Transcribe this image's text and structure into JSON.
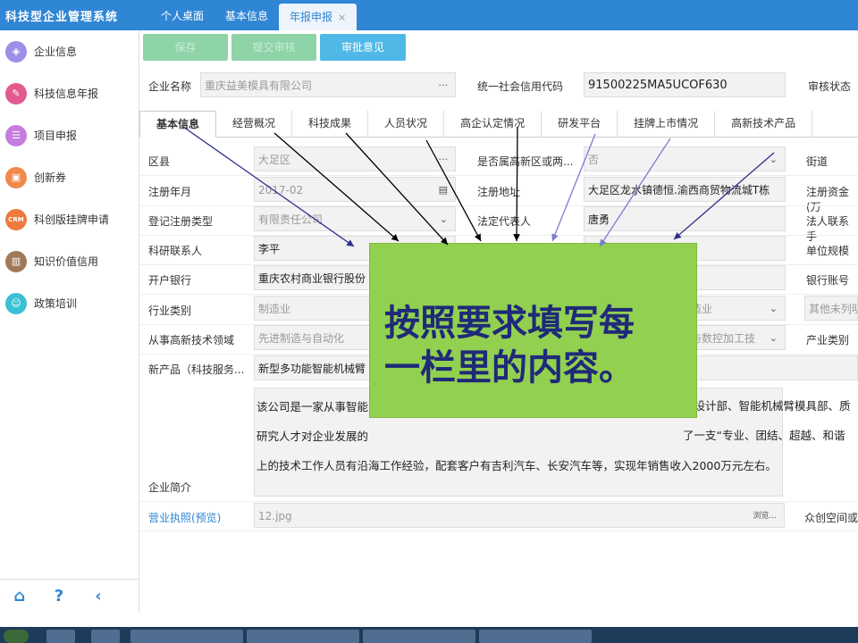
{
  "app": {
    "title": "科技型企业管理系统"
  },
  "tabs": [
    {
      "label": "个人桌面"
    },
    {
      "label": "基本信息"
    },
    {
      "label": "年报申报",
      "close": "×"
    }
  ],
  "sidebar": {
    "items": [
      {
        "label": "企业信息",
        "icon": "enterprise-icon",
        "color": "#9b8fe8"
      },
      {
        "label": "科技信息年报",
        "icon": "report-icon",
        "color": "#e25a8e"
      },
      {
        "label": "项目申报",
        "icon": "project-icon",
        "color": "#c67de0"
      },
      {
        "label": "创新券",
        "icon": "voucher-icon",
        "color": "#f08a4b"
      },
      {
        "label": "科创版挂牌申请",
        "icon": "crm-icon",
        "color": "#ee7a3e",
        "badge": "CRM"
      },
      {
        "label": "知识价值信用",
        "icon": "book-icon",
        "color": "#a07a58"
      },
      {
        "label": "政策培训",
        "icon": "user-icon",
        "color": "#3cc0d6"
      }
    ],
    "bottom": [
      {
        "icon": "home-icon",
        "glyph": "⌂"
      },
      {
        "icon": "help-icon",
        "glyph": "?"
      },
      {
        "icon": "collapse-icon",
        "glyph": "‹"
      }
    ]
  },
  "toolbar": {
    "save": "保存",
    "submit": "提交审核",
    "approve": "审批意见"
  },
  "header": {
    "company_label": "企业名称",
    "company": "重庆益美模具有限公司",
    "credit_label": "统一社会信用代码",
    "credit": "91500225MA5UCOF630",
    "status_label": "审核状态"
  },
  "subtabs": [
    "基本信息",
    "经营概况",
    "科技成果",
    "人员状况",
    "高企认定情况",
    "研发平台",
    "挂牌上市情况",
    "高新技术产品"
  ],
  "form": {
    "county_label": "区县",
    "county": "大足区",
    "hightech_zone_label": "是否属高新区或两...",
    "hightech_zone": "否",
    "street_label": "街道",
    "reg_date_label": "注册年月",
    "reg_date": "2017-02",
    "reg_addr_label": "注册地址",
    "reg_addr": "大足区龙水镇德恒.渝西商贸物流城T栋",
    "reg_capital_label": "注册资金(万",
    "reg_type_label": "登记注册类型",
    "reg_type": "有限责任公司",
    "legal_rep_label": "法定代表人",
    "legal_rep": "唐勇",
    "legal_contact_label": "法人联系手",
    "research_contact_label": "科研联系人",
    "research_contact": "李平",
    "unit_scale_label": "单位规模",
    "bank_label": "开户银行",
    "bank": "重庆农村商业银行股份",
    "bank_tail": "司",
    "bank_account_label": "银行账号",
    "industry_label": "行业类别",
    "industry": "制造业",
    "industry2": "制造业",
    "industry3": "其他未列明",
    "field_label": "从事高新技术领域",
    "field": "先进制造与自动化",
    "field2": "备与数控加工技",
    "product_cat_label": "产业类别",
    "new_product_label": "新产品（科技服务...",
    "new_product": "新型多功能智能机械臂",
    "intro_label": "企业简介",
    "intro_lines": [
      "该公司是一家从事智能",
      "研究人才对企业发展的",
      "上的技术工作人员有沿海工作经验，配套客户有吉利汽车、长安汽车等，实现年销售收入2000万元左右。"
    ],
    "intro_right_lines": [
      "设设计部、智能机械臂模具部、质",
      "了一支“专业、团结、超越、和谐"
    ],
    "license_label": "营业执照(预览)",
    "license_file": "12.jpg",
    "browse": "浏览...",
    "incubator_label": "众创空间或"
  },
  "overlay": {
    "line1": "按照要求填写每",
    "line2": "一栏里的内容。"
  }
}
